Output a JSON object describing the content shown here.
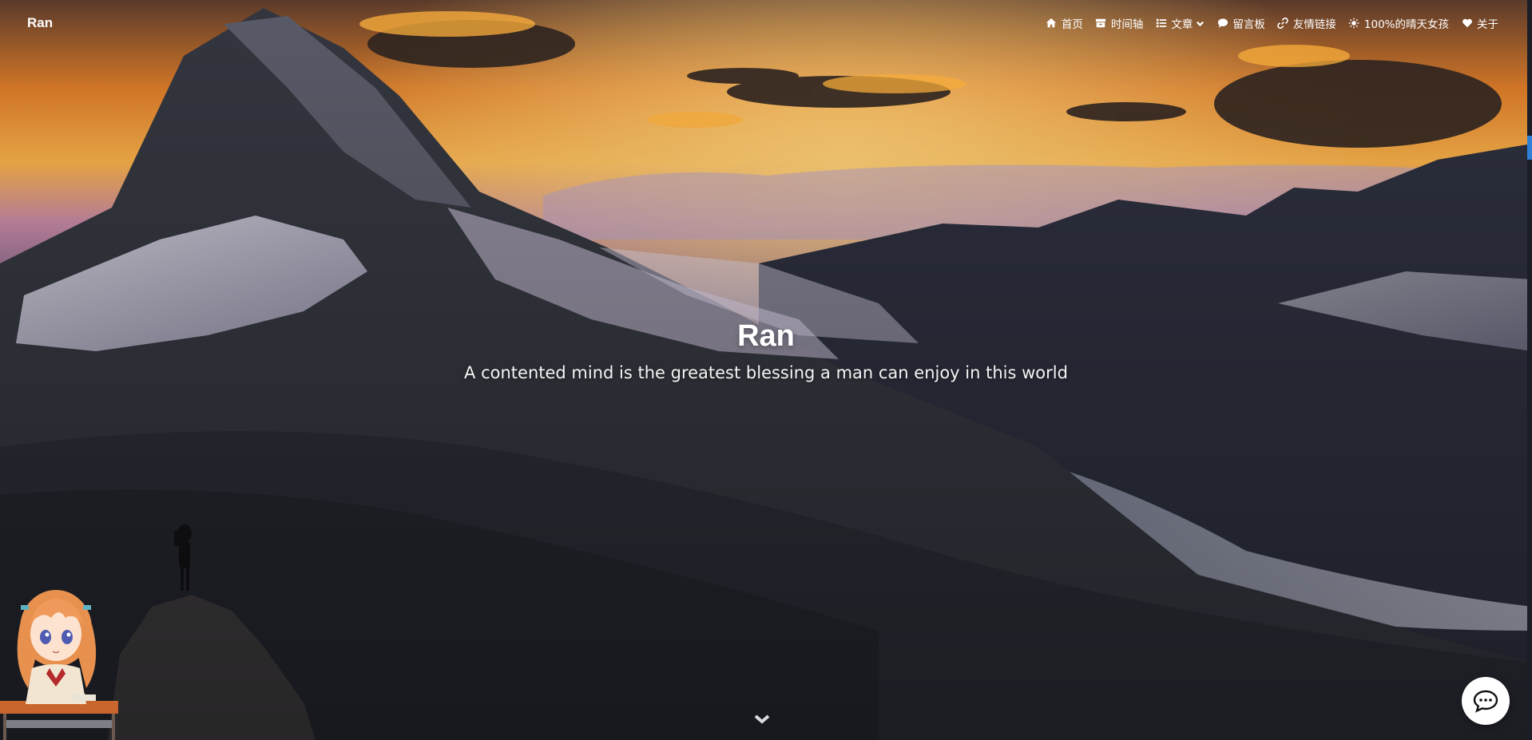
{
  "navbar": {
    "brand": "Ran",
    "items": [
      {
        "label": "首页",
        "icon": "home-icon"
      },
      {
        "label": "时间轴",
        "icon": "archive-icon"
      },
      {
        "label": "文章",
        "icon": "list-icon",
        "dropdown": true
      },
      {
        "label": "留言板",
        "icon": "comment-icon"
      },
      {
        "label": "友情链接",
        "icon": "link-icon"
      },
      {
        "label": "100%的晴天女孩",
        "icon": "sun-icon"
      },
      {
        "label": "关于",
        "icon": "heart-icon"
      }
    ]
  },
  "hero": {
    "title": "Ran",
    "subtitle": "A contented mind is the greatest blessing a man can enjoy in this world"
  },
  "icons": {
    "scroll": "chevron-down-icon",
    "chat": "chat-bubble-icon",
    "mascot": "anime-girl-mascot"
  },
  "colors": {
    "sky_top": "#2a2a35",
    "sunset": "#f39a2e",
    "mountain": "#2b2f3a",
    "snow": "#d8d6e2",
    "accent_scroll": "#2f7fd6"
  }
}
